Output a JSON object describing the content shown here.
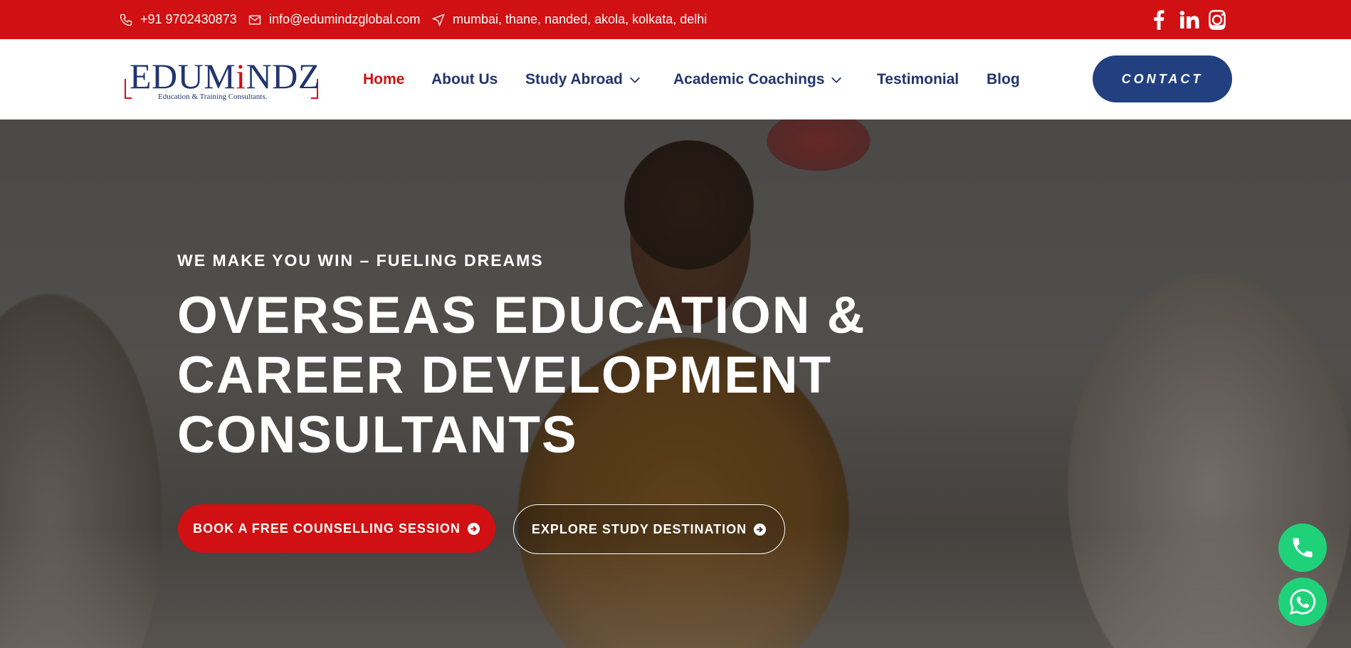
{
  "topbar": {
    "phone": "+91 9702430873",
    "email": "info@edumindzglobal.com",
    "locations": "mumbai, thane, nanded, akola, kolkata, delhi",
    "background_color": "#d01012",
    "social_icons": [
      "facebook-icon",
      "linkedin-icon",
      "instagram-icon"
    ]
  },
  "header": {
    "logo": {
      "word_part1": "EDUM",
      "word_accent": "i",
      "word_part2": "NDZ",
      "tagline": "Education & Training Consultants."
    },
    "nav": [
      {
        "label": "Home",
        "active": true,
        "has_dropdown": false
      },
      {
        "label": "About Us",
        "active": false,
        "has_dropdown": false
      },
      {
        "label": "Study Abroad",
        "active": false,
        "has_dropdown": true
      },
      {
        "label": "Academic Coachings",
        "active": false,
        "has_dropdown": true
      },
      {
        "label": "Testimonial",
        "active": false,
        "has_dropdown": false
      },
      {
        "label": "Blog",
        "active": false,
        "has_dropdown": false
      }
    ],
    "contact_button": "CONTACT",
    "brand_color": "#22356f",
    "accent_color": "#d01012"
  },
  "hero": {
    "eyebrow": "WE MAKE YOU WIN – FUELING DREAMS",
    "headline": [
      "OVERSEAS EDUCATION &",
      "CAREER DEVELOPMENT",
      "CONSULTANTS"
    ],
    "primary_button": "BOOK A FREE COUNSELLING SESSION",
    "secondary_button": "EXPLORE STUDY DESTINATION"
  },
  "floating": {
    "phone_icon": "phone-icon",
    "whatsapp_icon": "whatsapp-icon",
    "color": "#1fd27a"
  }
}
